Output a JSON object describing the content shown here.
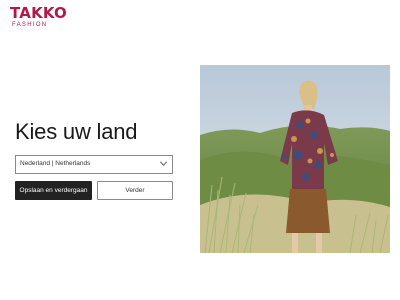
{
  "brand": {
    "name": "TAKKO",
    "tagline": "FASHION",
    "color": "#b5174b"
  },
  "page": {
    "heading": "Kies uw land"
  },
  "country_select": {
    "value": "Nederland | Netherlands",
    "icon": "chevron-down-icon"
  },
  "actions": {
    "save_label": "Opslaan en verdergaan",
    "continue_label": "Verder"
  },
  "hero_image": {
    "subject": "model-in-dunes-photo"
  },
  "colors": {
    "brand": "#b5174b",
    "primary_button": "#222222"
  }
}
